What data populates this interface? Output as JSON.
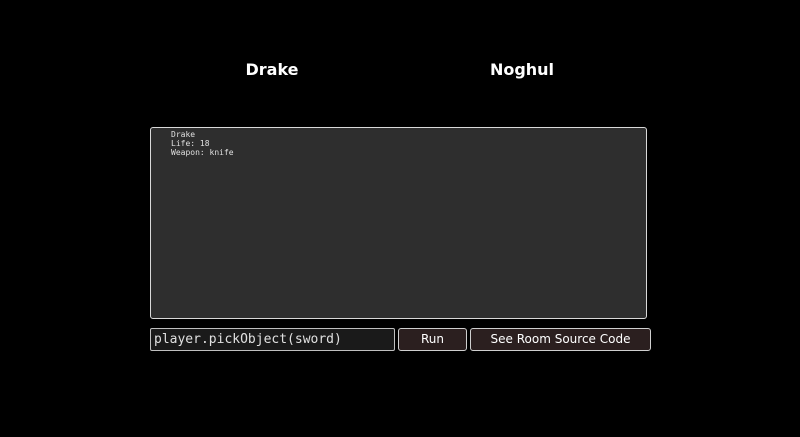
{
  "players": {
    "left_name": "Drake",
    "right_name": "Noghul"
  },
  "console": {
    "lines": [
      "Drake",
      "Life: 18",
      "Weapon: knife"
    ]
  },
  "command": {
    "value": "player.pickObject(sword)"
  },
  "buttons": {
    "run_label": "Run",
    "source_label": "See Room Source Code"
  }
}
